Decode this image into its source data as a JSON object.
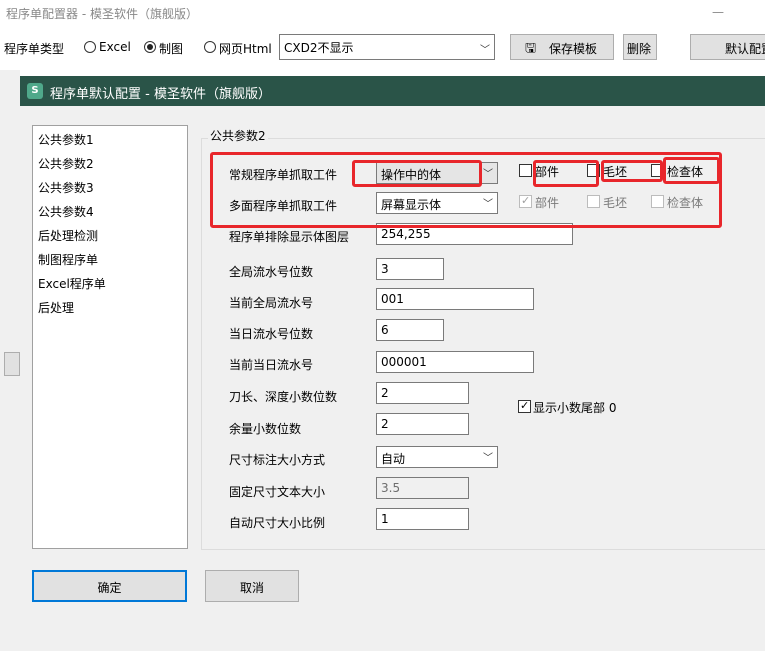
{
  "app": {
    "title": "程序单配置器 - 模圣软件（旗舰版）"
  },
  "toolbar": {
    "type_label": "程序单类型",
    "radio_excel": "Excel",
    "radio_drawing": "制图",
    "radio_web": "网页Html",
    "template_value": "CXD2不显示",
    "save_template": "保存模板",
    "delete": "删除",
    "default_config": "默认配置"
  },
  "dialog": {
    "title": "程序单默认配置 - 模圣软件（旗舰版）",
    "nav": [
      "公共参数1",
      "公共参数2",
      "公共参数3",
      "公共参数4",
      "后处理检测",
      "制图程序单",
      "Excel程序单",
      "后处理"
    ],
    "group_title": "公共参数2",
    "row1": {
      "label": "常规程序单抓取工件",
      "value": "操作中的体",
      "chk_part": "部件",
      "chk_blank": "毛坯",
      "chk_inspect": "检查体"
    },
    "row2": {
      "label": "多面程序单抓取工件",
      "value": "屏幕显示体",
      "chk_part": "部件",
      "chk_blank": "毛坯",
      "chk_inspect": "检查体"
    },
    "row3": {
      "label": "程序单排除显示体图层",
      "value": "254,255"
    },
    "row4": {
      "label": "全局流水号位数",
      "value": "3"
    },
    "row5": {
      "label": "当前全局流水号",
      "value": "001"
    },
    "row6": {
      "label": "当日流水号位数",
      "value": "6"
    },
    "row7": {
      "label": "当前当日流水号",
      "value": "000001"
    },
    "row8": {
      "label": "刀长、深度小数位数",
      "value": "2"
    },
    "show_trailing_zero": "显示小数尾部 0",
    "row9": {
      "label": "余量小数位数",
      "value": "2"
    },
    "row10": {
      "label": "尺寸标注大小方式",
      "value": "自动"
    },
    "row11": {
      "label": "固定尺寸文本大小",
      "value": "3.5"
    },
    "row12": {
      "label": "自动尺寸大小比例",
      "value": "1"
    },
    "ok": "确定",
    "cancel": "取消"
  },
  "colors": {
    "dialog_title_bar": "#2a5448",
    "highlight": "#e8262b"
  }
}
